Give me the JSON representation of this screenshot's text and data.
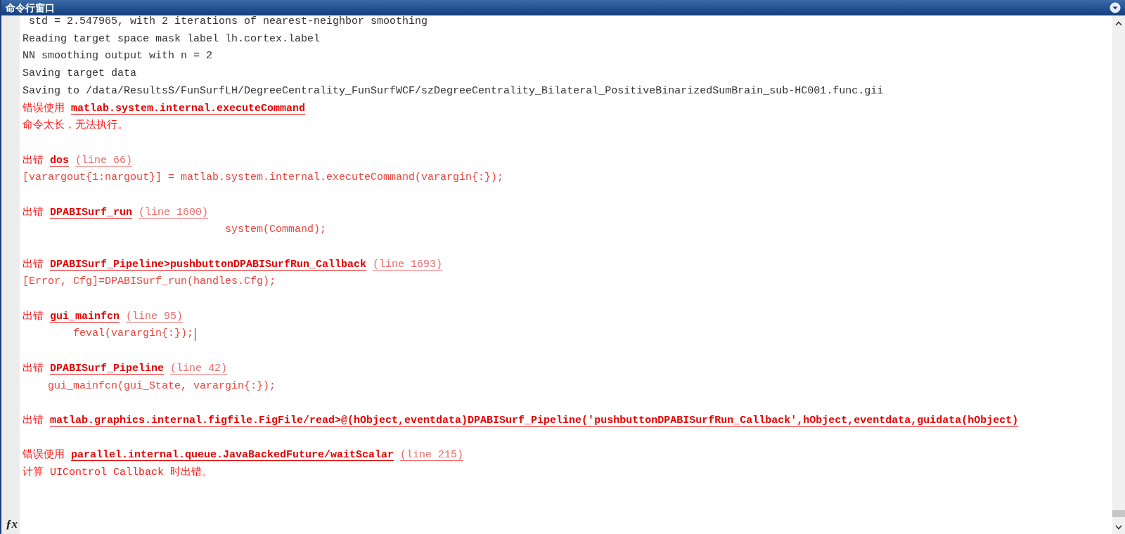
{
  "window": {
    "title": "命令行窗口"
  },
  "prompt_icon": "ƒx",
  "lines": [
    {
      "kind": "output",
      "text": " std = 2.547965, with 2 iterations of nearest-neighbor smoothing"
    },
    {
      "kind": "output",
      "text": "Reading target space mask label lh.cortex.label"
    },
    {
      "kind": "output",
      "text": "NN smoothing output with n = 2"
    },
    {
      "kind": "output",
      "text": "Saving target data"
    },
    {
      "kind": "output",
      "text": "Saving to /data/ResultsS/FunSurfLH/DegreeCentrality_FunSurfWCF/szDegreeCentrality_Bilateral_PositiveBinarizedSumBrain_sub-HC001.func.gii"
    },
    {
      "kind": "error_header",
      "prefix": "错误使用",
      "link": "matlab.system.internal.executeCommand"
    },
    {
      "kind": "error_text",
      "text": "命令太长，无法执行。"
    },
    {
      "kind": "blank"
    },
    {
      "kind": "error_header",
      "prefix": "出错",
      "link": "dos",
      "line_ref": "(line 66)"
    },
    {
      "kind": "error_code",
      "text": "[varargout{1:nargout}] = matlab.system.internal.executeCommand(varargin{:});"
    },
    {
      "kind": "blank"
    },
    {
      "kind": "error_header",
      "prefix": "出错",
      "link": "DPABISurf_run",
      "line_ref": "(line 1600)"
    },
    {
      "kind": "error_code",
      "text": "                                system(Command);"
    },
    {
      "kind": "blank"
    },
    {
      "kind": "error_header",
      "prefix": "出错",
      "link": "DPABISurf_Pipeline>pushbuttonDPABISurfRun_Callback",
      "line_ref": "(line 1693)"
    },
    {
      "kind": "error_code",
      "text": "[Error, Cfg]=DPABISurf_run(handles.Cfg);"
    },
    {
      "kind": "blank"
    },
    {
      "kind": "error_header",
      "prefix": "出错",
      "link": "gui_mainfcn",
      "line_ref": "(line 95)"
    },
    {
      "kind": "error_code",
      "text": "        feval(varargin{:});",
      "cursor": true
    },
    {
      "kind": "blank"
    },
    {
      "kind": "error_header",
      "prefix": "出错",
      "link": "DPABISurf_Pipeline",
      "line_ref": "(line 42)"
    },
    {
      "kind": "error_code",
      "text": "    gui_mainfcn(gui_State, varargin{:});"
    },
    {
      "kind": "blank"
    },
    {
      "kind": "error_header",
      "prefix": "出错",
      "link": "matlab.graphics.internal.figfile.FigFile/read>@(hObject,eventdata)DPABISurf_Pipeline('pushbuttonDPABISurfRun_Callback',hObject,eventdata,guidata(hObject)"
    },
    {
      "kind": "blank"
    },
    {
      "kind": "error_header",
      "prefix": "错误使用",
      "link": "parallel.internal.queue.JavaBackedFuture/waitScalar",
      "line_ref": "(line 215)"
    },
    {
      "kind": "error_text",
      "text": "计算 UIControl Callback 时出错。"
    }
  ]
}
